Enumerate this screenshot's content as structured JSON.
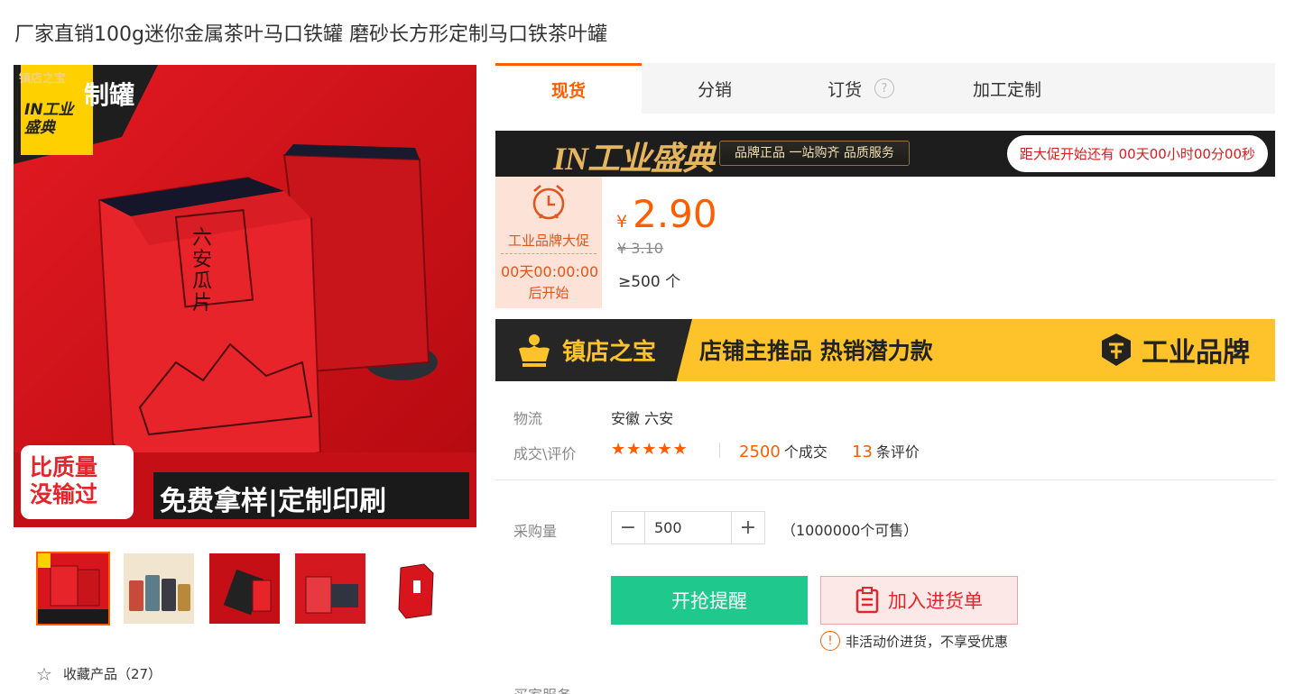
{
  "product": {
    "title": "厂家直销100g迷你金属茶叶马口铁罐 磨砂长方形定制马口铁茶叶罐"
  },
  "gallery": {
    "main_image": {
      "store_tag": "镇店之宝",
      "corner_text": "制罐",
      "event_logo": "IN工业盛典",
      "can_text": "六安瓜片",
      "badge_line1": "比质量",
      "badge_line2": "没输过",
      "bottom_text": "免费拿样|定制印刷"
    },
    "thumbnails": [
      "thumb-1",
      "thumb-2",
      "thumb-3",
      "thumb-4",
      "thumb-5"
    ],
    "favorite_label": "收藏产品（27）"
  },
  "tabs": [
    {
      "label": "现货",
      "active": true
    },
    {
      "label": "分销",
      "active": false
    },
    {
      "label": "订货",
      "active": false,
      "help": "?"
    },
    {
      "label": "加工定制",
      "active": false
    }
  ],
  "promo": {
    "logo": "IN工业盛典",
    "slogan": "品牌正品 一站购齐 品质服务",
    "countdown": "距大促开始还有 00天00小时00分00秒"
  },
  "price_badge": {
    "title": "工业品牌大促",
    "timer": "00天00:00:00",
    "after": "后开始"
  },
  "price": {
    "currency": "¥",
    "value": "2.90",
    "original": "¥ 3.10",
    "min_qty": "≥500 个"
  },
  "store_banner": {
    "name": "镇店之宝",
    "tag": "店铺主推品  热销潜力款",
    "brand": "工业品牌"
  },
  "info": {
    "logistics_label": "物流",
    "logistics_value": "安徽 六安",
    "rating_label": "成交\\评价",
    "stars": "★★★★★",
    "deals_count": "2500",
    "deals_suffix": "个成交",
    "reviews_count": "13",
    "reviews_suffix": "条评价"
  },
  "purchase": {
    "qty_label": "采购量",
    "qty_value": "500",
    "minus": "−",
    "plus": "+",
    "available": "（1000000个可售）",
    "remind_label": "开抢提醒",
    "cart_label": "加入进货单",
    "notice": "非活动价进货，不享受优惠",
    "services_label": "买家服务"
  },
  "colors": {
    "accent": "#ff5d00",
    "remind_green": "#1fc98e",
    "cart_red": "#e4262b",
    "store_yellow": "#fec32a"
  }
}
